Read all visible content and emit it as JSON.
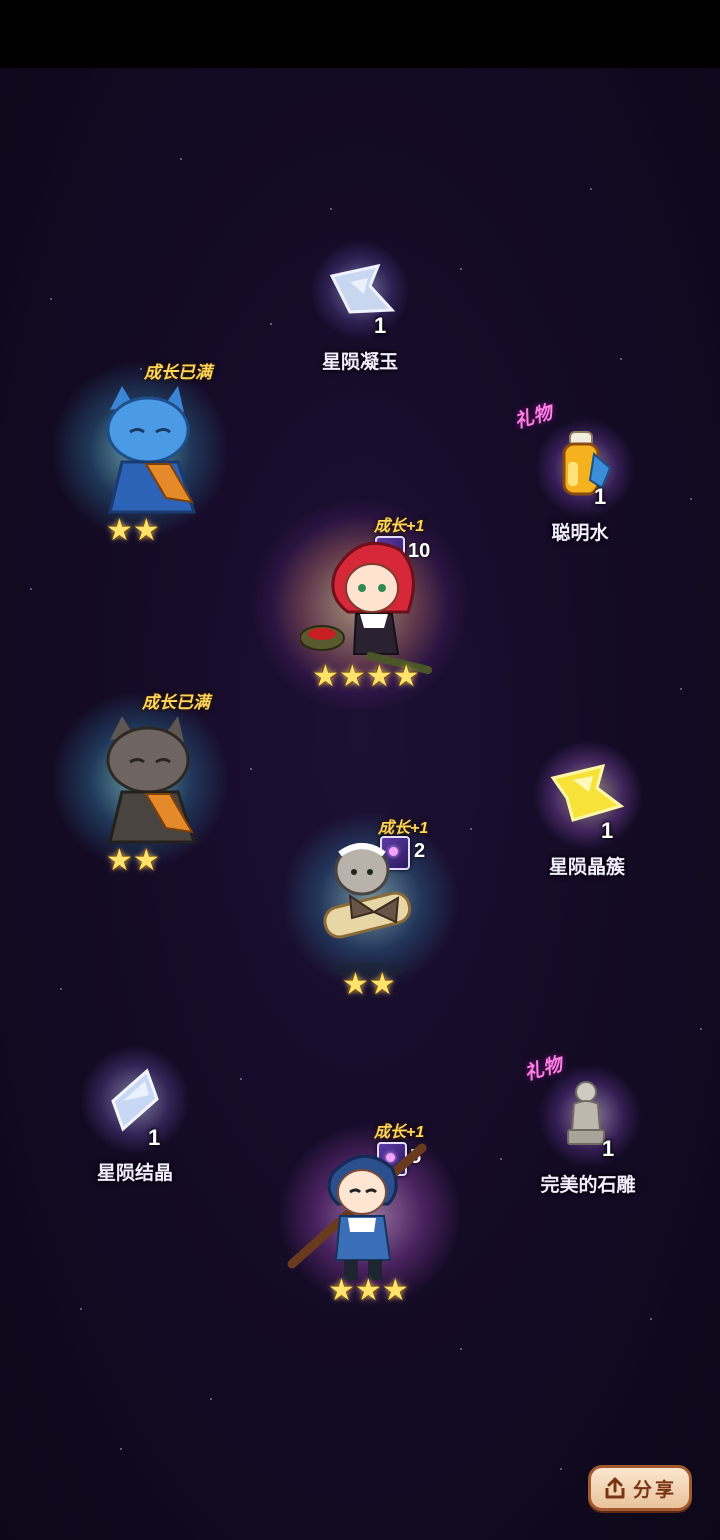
{
  "items": [
    {
      "name": "星陨凝玉",
      "count": "1",
      "icon": "star-jade-icon"
    },
    {
      "name": "聪明水",
      "count": "1",
      "icon": "smart-water-bottle-icon",
      "tag": "礼物"
    },
    {
      "name": "星陨晶簇",
      "count": "1",
      "icon": "star-cluster-icon"
    },
    {
      "name": "星陨结晶",
      "count": "1",
      "icon": "star-crystal-icon"
    },
    {
      "name": "完美的石雕",
      "count": "1",
      "icon": "stone-statue-icon",
      "tag": "礼物"
    }
  ],
  "characters": [
    {
      "id": "blue-cat",
      "status": "成长已满",
      "stars": 2
    },
    {
      "id": "red-hair-girl",
      "status": "成长+1",
      "cards": "10",
      "stars": 4
    },
    {
      "id": "gray-cat",
      "status": "成长已满",
      "stars": 2
    },
    {
      "id": "scroll-mouse",
      "status": "成长+1",
      "cards": "2",
      "stars": 2
    },
    {
      "id": "blue-hair-boy",
      "status": "成长+1",
      "cards": "5",
      "stars": 3
    }
  ],
  "share_button": {
    "label": "分享",
    "icon": "share-icon"
  },
  "colors": {
    "background": "#150b27",
    "gift_tag": "#ff7fe6",
    "status_tag": "#ffd65a",
    "star": "#ffe36b"
  }
}
